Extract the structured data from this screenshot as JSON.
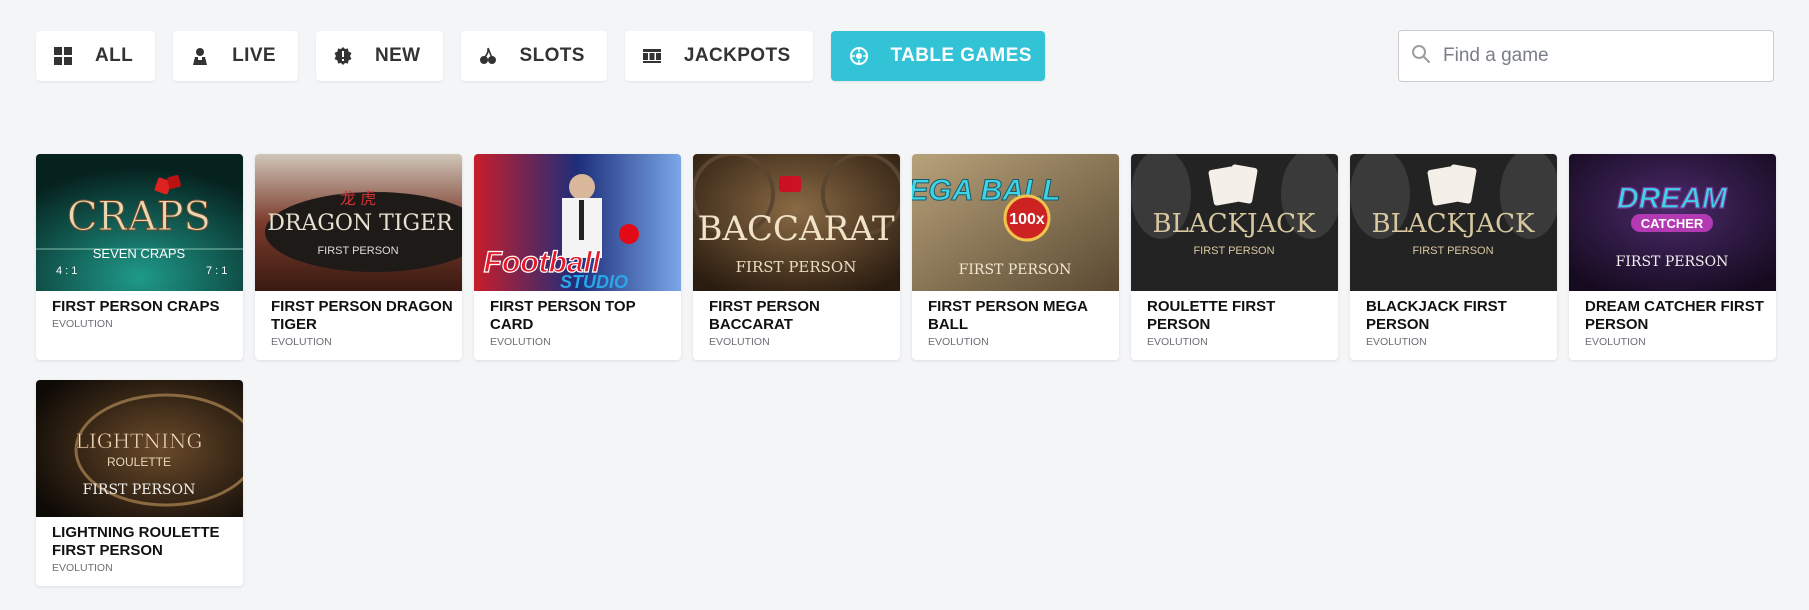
{
  "filters": [
    {
      "label": "ALL",
      "icon": "grid-icon",
      "active": false
    },
    {
      "label": "LIVE",
      "icon": "live-dealer-icon",
      "active": false
    },
    {
      "label": "NEW",
      "icon": "alert-badge-icon",
      "active": false
    },
    {
      "label": "SLOTS",
      "icon": "cherries-icon",
      "active": false
    },
    {
      "label": "JACKPOTS",
      "icon": "slot-reels-icon",
      "active": false
    },
    {
      "label": "TABLE GAMES",
      "icon": "roulette-chip-icon",
      "active": true
    }
  ],
  "search": {
    "placeholder": "Find a game",
    "value": ""
  },
  "games": [
    {
      "title": "FIRST PERSON CRAPS",
      "provider": "EVOLUTION",
      "thumb_text": "CRAPS",
      "thumb_sub": "SEVEN CRAPS",
      "bg": "#0f5c55"
    },
    {
      "title": "FIRST PERSON DRAGON TIGER",
      "provider": "EVOLUTION",
      "thumb_text": "DRAGON TIGER",
      "thumb_sub": "FIRST PERSON",
      "bg": "#5a2a22"
    },
    {
      "title": "FIRST PERSON TOP CARD",
      "provider": "EVOLUTION",
      "thumb_text": "Football",
      "thumb_sub": "STUDIO",
      "bg": "#1a2a6e"
    },
    {
      "title": "FIRST PERSON BACCARAT",
      "provider": "EVOLUTION",
      "thumb_text": "BACCARAT",
      "thumb_sub": "FIRST PERSON",
      "bg": "#3a2716"
    },
    {
      "title": "FIRST PERSON MEGA BALL",
      "provider": "EVOLUTION",
      "thumb_text": "MEGA BALL",
      "thumb_sub": "FIRST PERSON",
      "bg": "#7a6a4a"
    },
    {
      "title": "ROULETTE FIRST PERSON",
      "provider": "EVOLUTION",
      "thumb_text": "BLACKJACK",
      "thumb_sub": "FIRST PERSON",
      "bg": "#2a2a2a"
    },
    {
      "title": "BLACKJACK FIRST PERSON",
      "provider": "EVOLUTION",
      "thumb_text": "BLACKJACK",
      "thumb_sub": "FIRST PERSON",
      "bg": "#2a2a2a"
    },
    {
      "title": "DREAM CATCHER FIRST PERSON",
      "provider": "EVOLUTION",
      "thumb_text": "DREAM",
      "thumb_sub": "FIRST PERSON",
      "bg": "#2a1a3a"
    },
    {
      "title": "LIGHTNING ROULETTE FIRST PERSON",
      "provider": "EVOLUTION",
      "thumb_text": "LIGHTNING",
      "thumb_sub": "FIRST PERSON",
      "bg": "#1a1410"
    }
  ],
  "colors": {
    "accent": "#33c3d6",
    "background": "#f4f5f7"
  }
}
